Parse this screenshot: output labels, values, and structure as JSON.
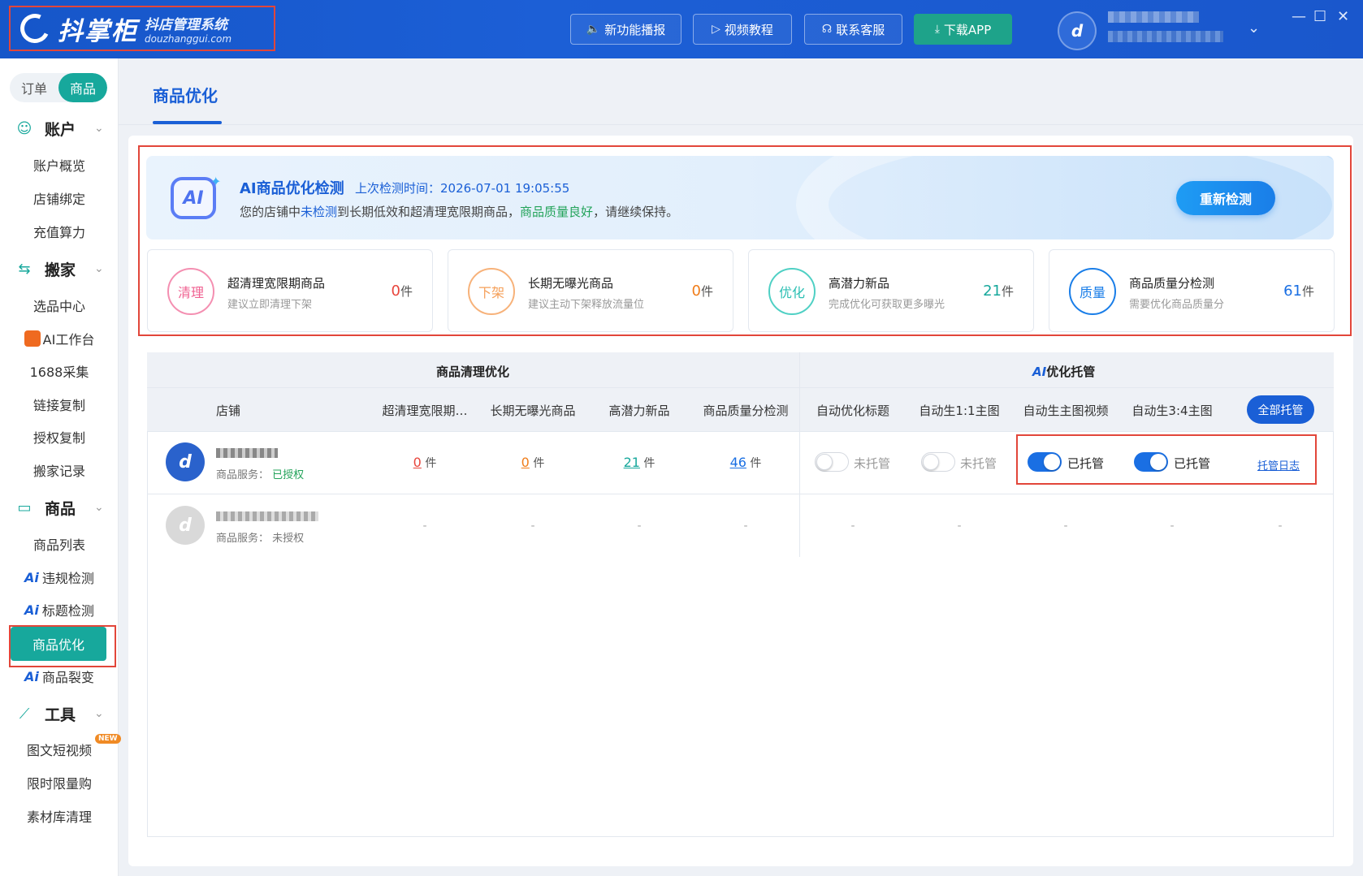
{
  "app": {
    "logo_title": "抖掌柜",
    "logo_sub1": "抖店管理系统",
    "logo_sub2": "douzhanggui.com"
  },
  "topbar": {
    "buttons": [
      {
        "label": "新功能播报",
        "icon": "speaker-icon"
      },
      {
        "label": "视频教程",
        "icon": "play-icon"
      },
      {
        "label": "联系客服",
        "icon": "headset-icon"
      },
      {
        "label": "下载APP",
        "icon": "download-icon"
      }
    ]
  },
  "sidebar": {
    "segment": [
      "订单",
      "商品"
    ],
    "groups": {
      "account": "账户",
      "move": "搬家",
      "product": "商品",
      "tools": "工具"
    },
    "items": {
      "account_overview": "账户概览",
      "shop_bind": "店铺绑定",
      "recharge": "充值算力",
      "selection": "选品中心",
      "ai_workbench": "AI工作台",
      "collect_1688": "1688采集",
      "link_copy": "链接复制",
      "auth_copy": "授权复制",
      "move_record": "搬家记录",
      "product_list": "商品列表",
      "violation": "违规检测",
      "title_check": "标题检测",
      "optimize": "商品优化",
      "fission": "商品裂变",
      "video": "图文短视频",
      "flash_sale": "限时限量购",
      "material_clean": "素材库清理"
    },
    "new_tag": "NEW",
    "ai_prefix": "Ai"
  },
  "page": {
    "tab": "商品优化"
  },
  "banner": {
    "title": "AI商品优化检测",
    "time_label": "上次检测时间：2026-07-01 19:05:55",
    "desc_pre": "您的店铺中",
    "desc_blue": "未检测",
    "desc_mid": "到长期低效和超清理宽限期商品，",
    "desc_green": "商品质量良好",
    "desc_post": "，请继续保持。",
    "recheck_button": "重新检测"
  },
  "cards": [
    {
      "badge": "清理",
      "title": "超清理宽限期商品",
      "sub": "建议立即清理下架",
      "value": "0",
      "unit": "件",
      "color": "#f06292",
      "value_color": "#e8453c"
    },
    {
      "badge": "下架",
      "title": "长期无曝光商品",
      "sub": "建议主动下架释放流量位",
      "value": "0",
      "unit": "件",
      "color": "#f5a05a",
      "value_color": "#f07d1a"
    },
    {
      "badge": "优化",
      "title": "高潜力新品",
      "sub": "完成优化可获取更多曝光",
      "value": "21",
      "unit": "件",
      "color": "#2bbfb3",
      "value_color": "#17a89c"
    },
    {
      "badge": "质量",
      "title": "商品质量分检测",
      "sub": "需要优化商品质量分",
      "value": "61",
      "unit": "件",
      "color": "#1a7ee8",
      "value_color": "#1a6fe3"
    }
  ],
  "table": {
    "group1": "商品清理优化",
    "group2_ai": "AI",
    "group2_rest": "优化托管",
    "columns": [
      "店铺",
      "超清理宽限期…",
      "长期无曝光商品",
      "高潜力新品",
      "商品质量分检测",
      "自动优化标题",
      "自动生1:1主图",
      "自动生主图视频",
      "自动生3:4主图"
    ],
    "all_trust_button": "全部托管",
    "rows": [
      {
        "service_label": "商品服务：",
        "service_status": "已授权",
        "c1": "0",
        "c2": "0",
        "c3": "21",
        "c4": "46",
        "unit": "件",
        "t1": "未托管",
        "t2": "未托管",
        "t3": "已托管",
        "t4": "已托管",
        "log_link": "托管日志"
      },
      {
        "service_label": "商品服务：",
        "service_status": "未授权",
        "dash": "-"
      }
    ]
  }
}
